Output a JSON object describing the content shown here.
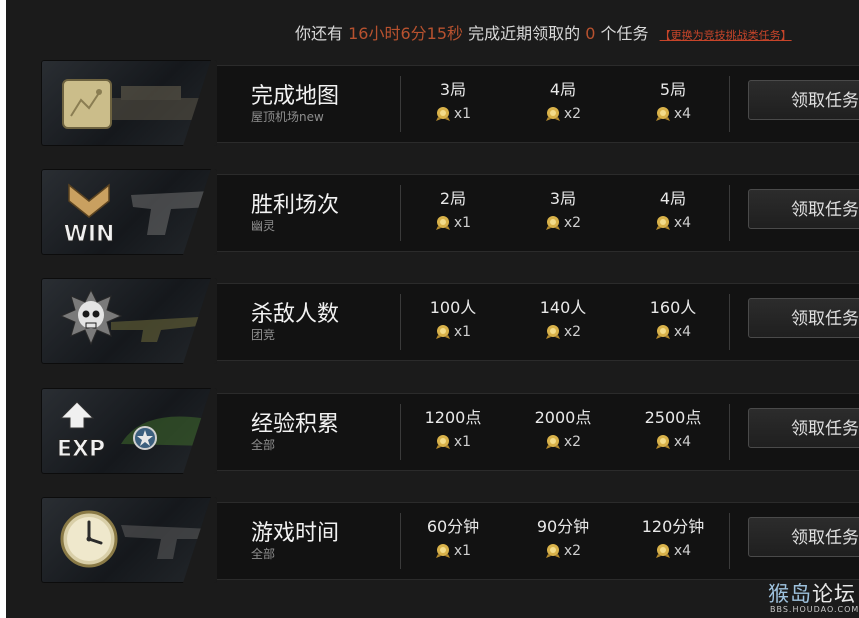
{
  "header": {
    "prefix": "你还有",
    "time_left": "16小时6分15秒",
    "middle": "完成近期领取的",
    "count": "0",
    "suffix": "个任务",
    "switch_link": "【更换为竞技挑战类任务】"
  },
  "tasks": [
    {
      "title": "完成地图",
      "subtitle": "屋顶机场new",
      "icon": "map-icon",
      "tiers": [
        {
          "req": "3局",
          "reward": "x1"
        },
        {
          "req": "4局",
          "reward": "x2"
        },
        {
          "req": "5局",
          "reward": "x4"
        }
      ],
      "button": "领取任务"
    },
    {
      "title": "胜利场次",
      "subtitle": "幽灵",
      "icon": "win-icon",
      "tiers": [
        {
          "req": "2局",
          "reward": "x1"
        },
        {
          "req": "3局",
          "reward": "x2"
        },
        {
          "req": "4局",
          "reward": "x4"
        }
      ],
      "button": "领取任务"
    },
    {
      "title": "杀敌人数",
      "subtitle": "团竞",
      "icon": "skull-icon",
      "tiers": [
        {
          "req": "100人",
          "reward": "x1"
        },
        {
          "req": "140人",
          "reward": "x2"
        },
        {
          "req": "160人",
          "reward": "x4"
        }
      ],
      "button": "领取任务"
    },
    {
      "title": "经验积累",
      "subtitle": "全部",
      "icon": "exp-icon",
      "tiers": [
        {
          "req": "1200点",
          "reward": "x1"
        },
        {
          "req": "2000点",
          "reward": "x2"
        },
        {
          "req": "2500点",
          "reward": "x4"
        }
      ],
      "button": "领取任务"
    },
    {
      "title": "游戏时间",
      "subtitle": "全部",
      "icon": "clock-icon",
      "tiers": [
        {
          "req": "60分钟",
          "reward": "x1"
        },
        {
          "req": "90分钟",
          "reward": "x2"
        },
        {
          "req": "120分钟",
          "reward": "x4"
        }
      ],
      "button": "领取任务"
    }
  ],
  "watermark": {
    "name_a": "猴岛",
    "name_b": "论坛",
    "url": "BBS.HOUDAO.COM"
  },
  "colors": {
    "background": "#1b1b1b",
    "highlight": "#b8522f",
    "link": "#c8452a",
    "medal": "#d9b24a"
  }
}
